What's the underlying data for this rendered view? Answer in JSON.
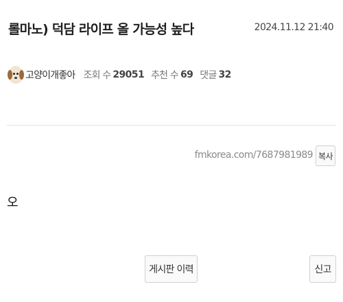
{
  "post": {
    "title": "롤마노) 덕담 라이프 올 가능성 높다",
    "date": "2024.11.12 21:40",
    "author": "고양이개좋아",
    "avatar_icon": "dog-avatar-icon",
    "stats": {
      "views_label": "조회 수",
      "views": "29051",
      "recommends_label": "추천 수",
      "recommends": "69",
      "comments_label": "댓글",
      "comments": "32"
    },
    "url": "fmkorea.com/7687981989",
    "copy_label": "복사",
    "content": "오"
  },
  "actions": {
    "history_label": "게시판 이력",
    "report_label": "신고"
  }
}
